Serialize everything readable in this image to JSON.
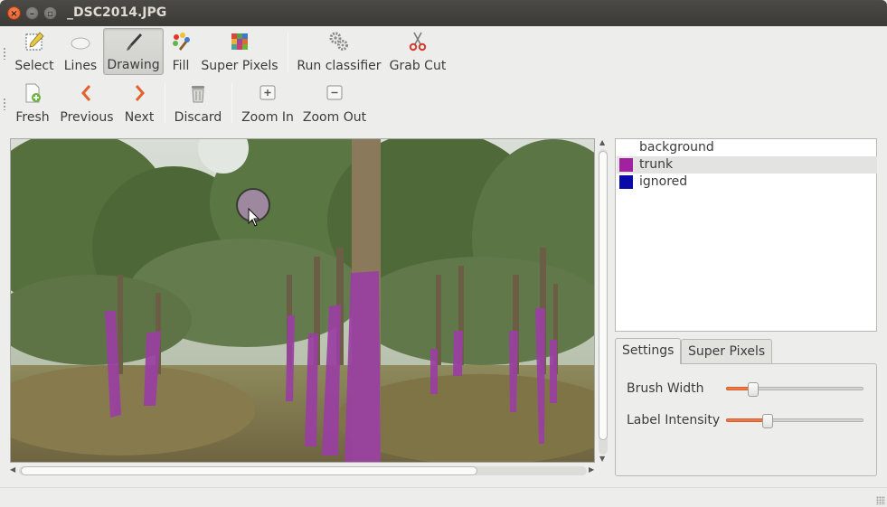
{
  "window": {
    "title": "_DSC2014.JPG"
  },
  "toolbar1": {
    "select": "Select",
    "lines": "Lines",
    "drawing": "Drawing",
    "fill": "Fill",
    "super_pixels": "Super Pixels",
    "run_classifier": "Run classifier",
    "grab_cut": "Grab Cut"
  },
  "toolbar2": {
    "fresh": "Fresh",
    "previous": "Previous",
    "next": "Next",
    "discard": "Discard",
    "zoom_in": "Zoom In",
    "zoom_out": "Zoom Out"
  },
  "labels": [
    {
      "name": "background",
      "color": ""
    },
    {
      "name": "trunk",
      "color": "#a0229f",
      "selected": true
    },
    {
      "name": "ignored",
      "color": "#0a0aa8"
    }
  ],
  "tabs": {
    "settings": "Settings",
    "super_pixels": "Super Pixels"
  },
  "settings": {
    "brush_width_label": "Brush Width",
    "brush_width_value": 0.2,
    "label_intensity_label": "Label Intensity",
    "label_intensity_value": 0.3
  },
  "colors": {
    "accent": "#f07746",
    "trunk_label": "#a0229f",
    "ignored_label": "#0a0aa8"
  }
}
